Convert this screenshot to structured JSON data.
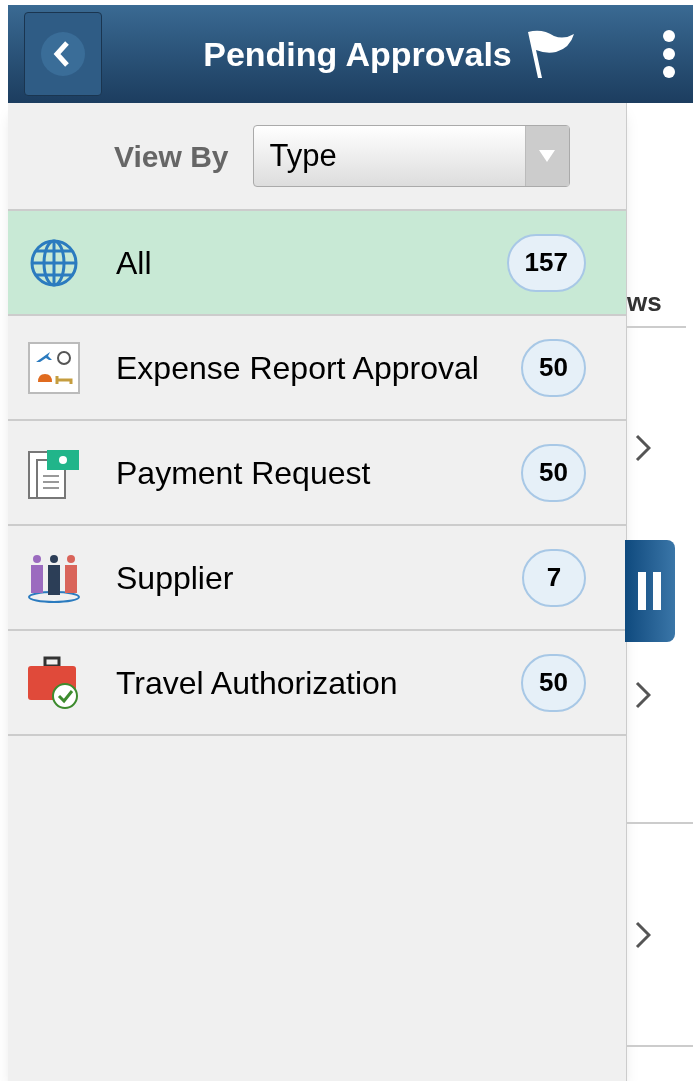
{
  "header": {
    "title": "Pending Approvals"
  },
  "view_by": {
    "label": "View By",
    "value": "Type"
  },
  "items": [
    {
      "kind": "all",
      "label": "All",
      "count": "157",
      "selected": true
    },
    {
      "kind": "expense",
      "label": "Expense Report Approval",
      "count": "50",
      "selected": false
    },
    {
      "kind": "payment",
      "label": "Payment Request",
      "count": "50",
      "selected": false
    },
    {
      "kind": "supplier",
      "label": "Supplier",
      "count": "7",
      "selected": false
    },
    {
      "kind": "travel",
      "label": "Travel Authorization",
      "count": "50",
      "selected": false
    }
  ],
  "background": {
    "column_heading": "ws"
  }
}
